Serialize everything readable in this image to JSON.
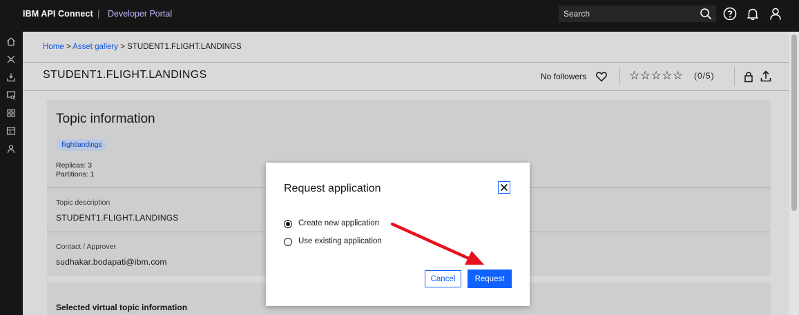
{
  "header": {
    "brand": "IBM API Connect",
    "separator": "|",
    "portal": "Developer Portal",
    "search_placeholder": "Search"
  },
  "sidebar": {
    "icons": [
      "home-icon",
      "api-network-icon",
      "download-icon",
      "search-list-icon",
      "apps-grid-icon",
      "table-icon",
      "user-icon"
    ]
  },
  "breadcrumb": {
    "home": "Home",
    "sep": ">",
    "gallery": "Asset gallery",
    "current": "STUDENT1.FLIGHT.LANDINGS"
  },
  "asset": {
    "title": "STUDENT1.FLIGHT.LANDINGS",
    "followers": "No followers",
    "stars": "☆☆☆☆☆",
    "rating": "(0/5)"
  },
  "topic": {
    "heading": "Topic information",
    "tag": "flightlandings",
    "replicas": "Replicas: 3",
    "partitions": "Partitions: 1",
    "description_label": "Topic description",
    "description_value": "STUDENT1.FLIGHT.LANDINGS",
    "contact_label": "Contact / Approver",
    "contact_value": "sudhakar.bodapati@ibm.com"
  },
  "virtual_topic": {
    "title": "Selected virtual topic information"
  },
  "modal": {
    "title": "Request application",
    "options": [
      {
        "label": "Create new application",
        "checked": true
      },
      {
        "label": "Use existing application",
        "checked": false
      }
    ],
    "cancel_label": "Cancel",
    "request_label": "Request"
  },
  "colors": {
    "accent": "#0f62fe",
    "annotation_arrow": "#e8101c",
    "topbar": "#161616"
  }
}
